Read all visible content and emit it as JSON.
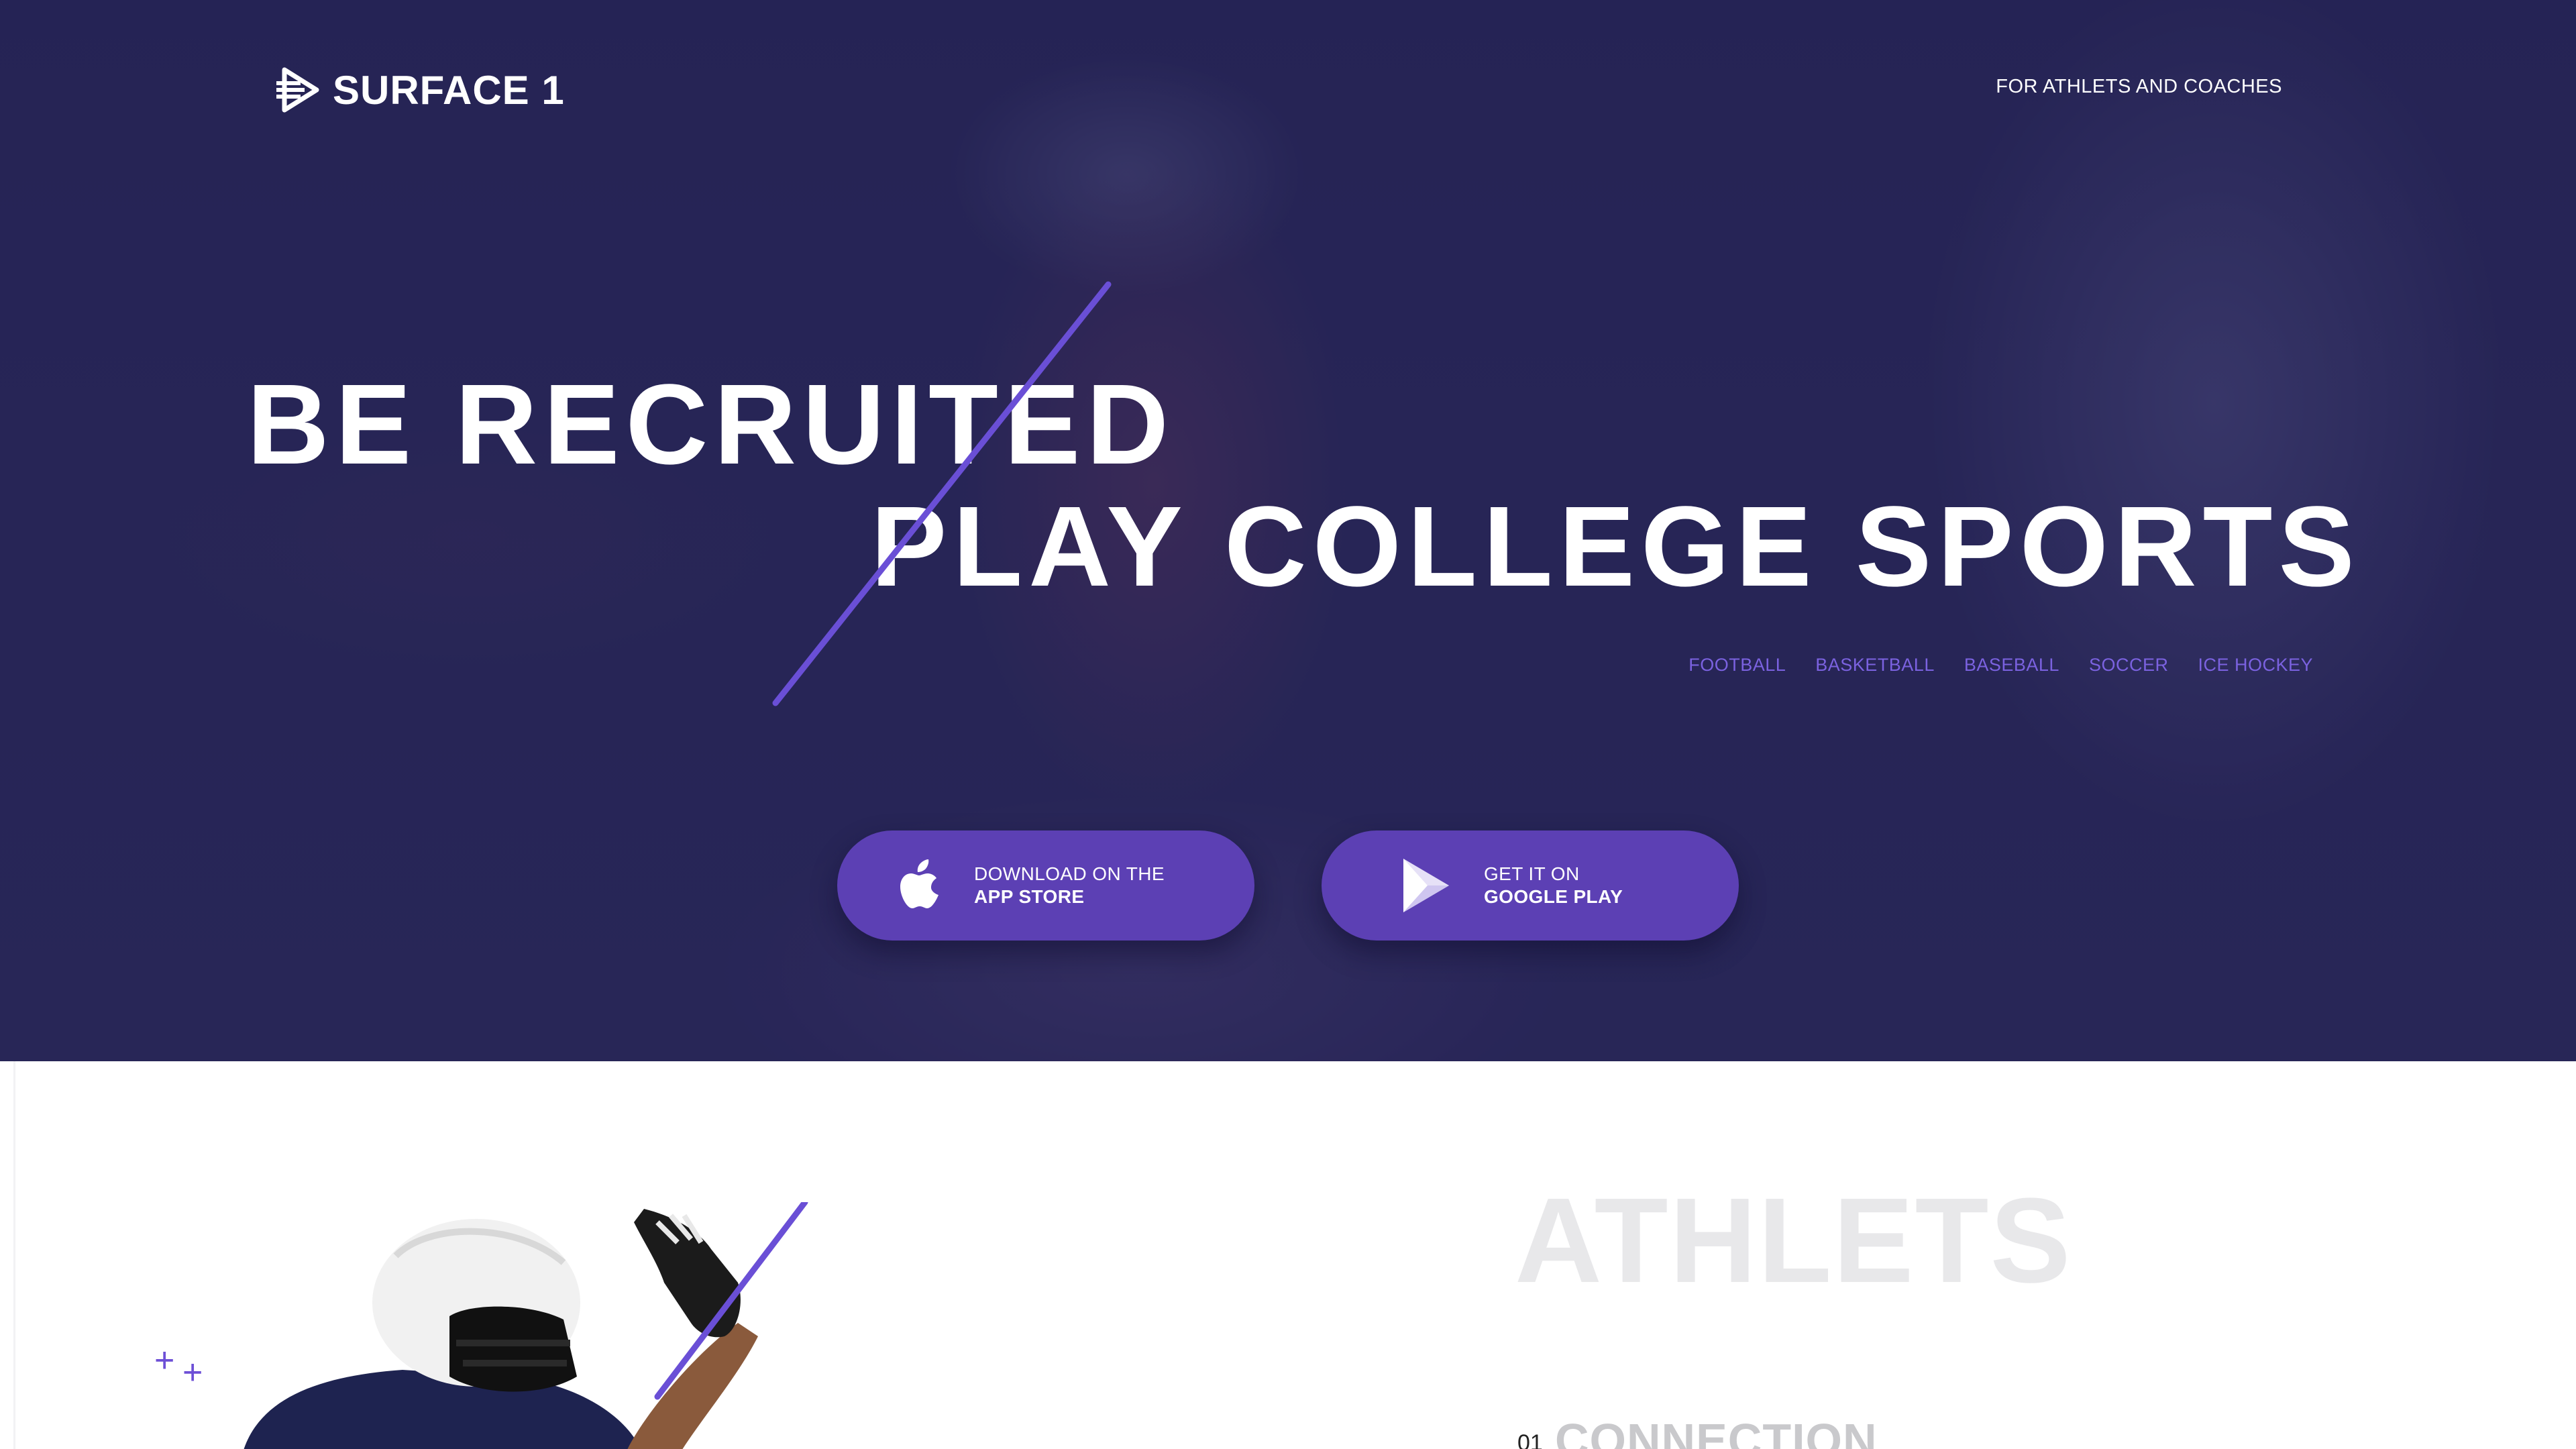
{
  "header": {
    "logo_text": "SURFACE 1",
    "top_link": "FOR ATHLETS AND COACHES"
  },
  "hero": {
    "headline_line1": "BE RECRUITED",
    "headline_line2": "PLAY COLLEGE SPORTS",
    "sports": [
      "FOOTBALL",
      "BASKETBALL",
      "BASEBALL",
      "SOCCER",
      "ICE HOCKEY"
    ],
    "app_store": {
      "line1": "DOWNLOAD ON THE",
      "line2": "APP STORE",
      "icon": "apple-icon"
    },
    "google_play": {
      "line1": "GET IT ON",
      "line2": "GOOGLE PLAY",
      "icon": "play-store-icon"
    }
  },
  "athletes": {
    "title": "ATHLETS",
    "feature_number": "01",
    "feature_title": "CONNECTION"
  },
  "colors": {
    "accent": "#5c40b4",
    "accent_text": "#7b62e0",
    "hero_bg": "#252350",
    "title_muted": "#e8e8ea"
  }
}
